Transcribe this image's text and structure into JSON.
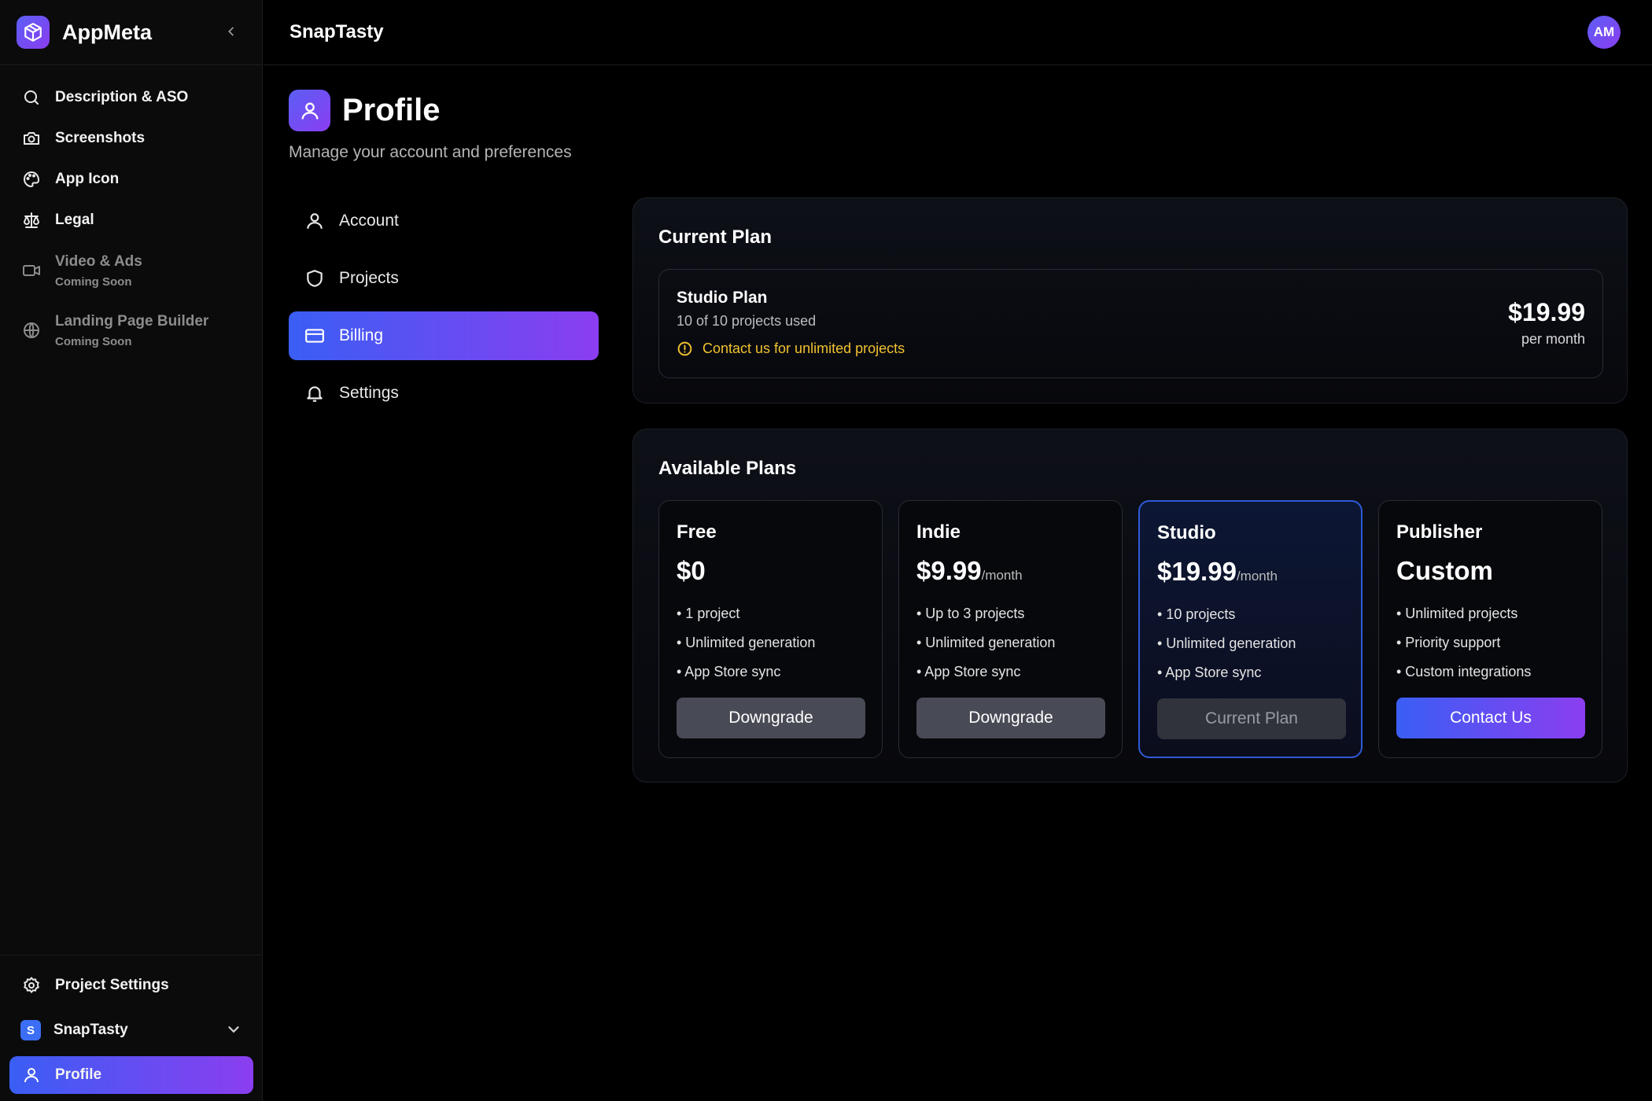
{
  "brand": {
    "name": "AppMeta"
  },
  "sidebar": {
    "items": [
      {
        "label": "Description & ASO",
        "icon": "search-icon"
      },
      {
        "label": "Screenshots",
        "icon": "camera-icon"
      },
      {
        "label": "App Icon",
        "icon": "palette-icon"
      },
      {
        "label": "Legal",
        "icon": "scale-icon"
      },
      {
        "label": "Video & Ads",
        "sub": "Coming Soon",
        "icon": "video-icon"
      },
      {
        "label": "Landing Page Builder",
        "sub": "Coming Soon",
        "icon": "globe-icon"
      }
    ],
    "bottom": {
      "project_settings": "Project Settings",
      "project_badge": "S",
      "project_name": "SnapTasty",
      "profile": "Profile"
    }
  },
  "topbar": {
    "project_title": "SnapTasty",
    "avatar_initials": "AM"
  },
  "page": {
    "title": "Profile",
    "subtitle": "Manage your account and preferences"
  },
  "tabs": [
    {
      "label": "Account",
      "icon": "user-icon"
    },
    {
      "label": "Projects",
      "icon": "shield-icon"
    },
    {
      "label": "Billing",
      "icon": "credit-card-icon",
      "active": true
    },
    {
      "label": "Settings",
      "icon": "bell-icon"
    }
  ],
  "current_plan": {
    "heading": "Current Plan",
    "name": "Studio Plan",
    "usage": "10 of 10 projects used",
    "warning": "Contact us for unlimited projects",
    "price": "$19.99",
    "period": "per month"
  },
  "available_plans": {
    "heading": "Available Plans",
    "plans": [
      {
        "name": "Free",
        "price": "$0",
        "per": "",
        "features": [
          "• 1 project",
          "• Unlimited generation",
          "• App Store sync"
        ],
        "button": "Downgrade"
      },
      {
        "name": "Indie",
        "price": "$9.99",
        "per": "/month",
        "features": [
          "• Up to 3 projects",
          "• Unlimited generation",
          "• App Store sync"
        ],
        "button": "Downgrade"
      },
      {
        "name": "Studio",
        "price": "$19.99",
        "per": "/month",
        "features": [
          "• 10 projects",
          "• Unlimited generation",
          "• App Store sync"
        ],
        "button": "Current Plan",
        "current": true
      },
      {
        "name": "Publisher",
        "price": "Custom",
        "per": "",
        "features": [
          "• Unlimited projects",
          "• Priority support",
          "• Custom integrations"
        ],
        "button": "Contact Us"
      }
    ]
  },
  "colors": {
    "accent_start": "#3a5ef4",
    "accent_end": "#8b3ef0",
    "warning": "#f2c230",
    "current_plan_border": "#2f5bd8"
  }
}
